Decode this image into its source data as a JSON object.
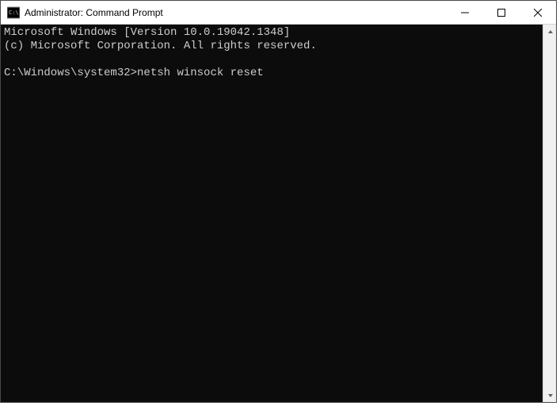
{
  "window": {
    "title": "Administrator: Command Prompt"
  },
  "terminal": {
    "line1": "Microsoft Windows [Version 10.0.19042.1348]",
    "line2": "(c) Microsoft Corporation. All rights reserved.",
    "blank": "",
    "prompt": "C:\\Windows\\system32>",
    "command": "netsh winsock reset"
  }
}
